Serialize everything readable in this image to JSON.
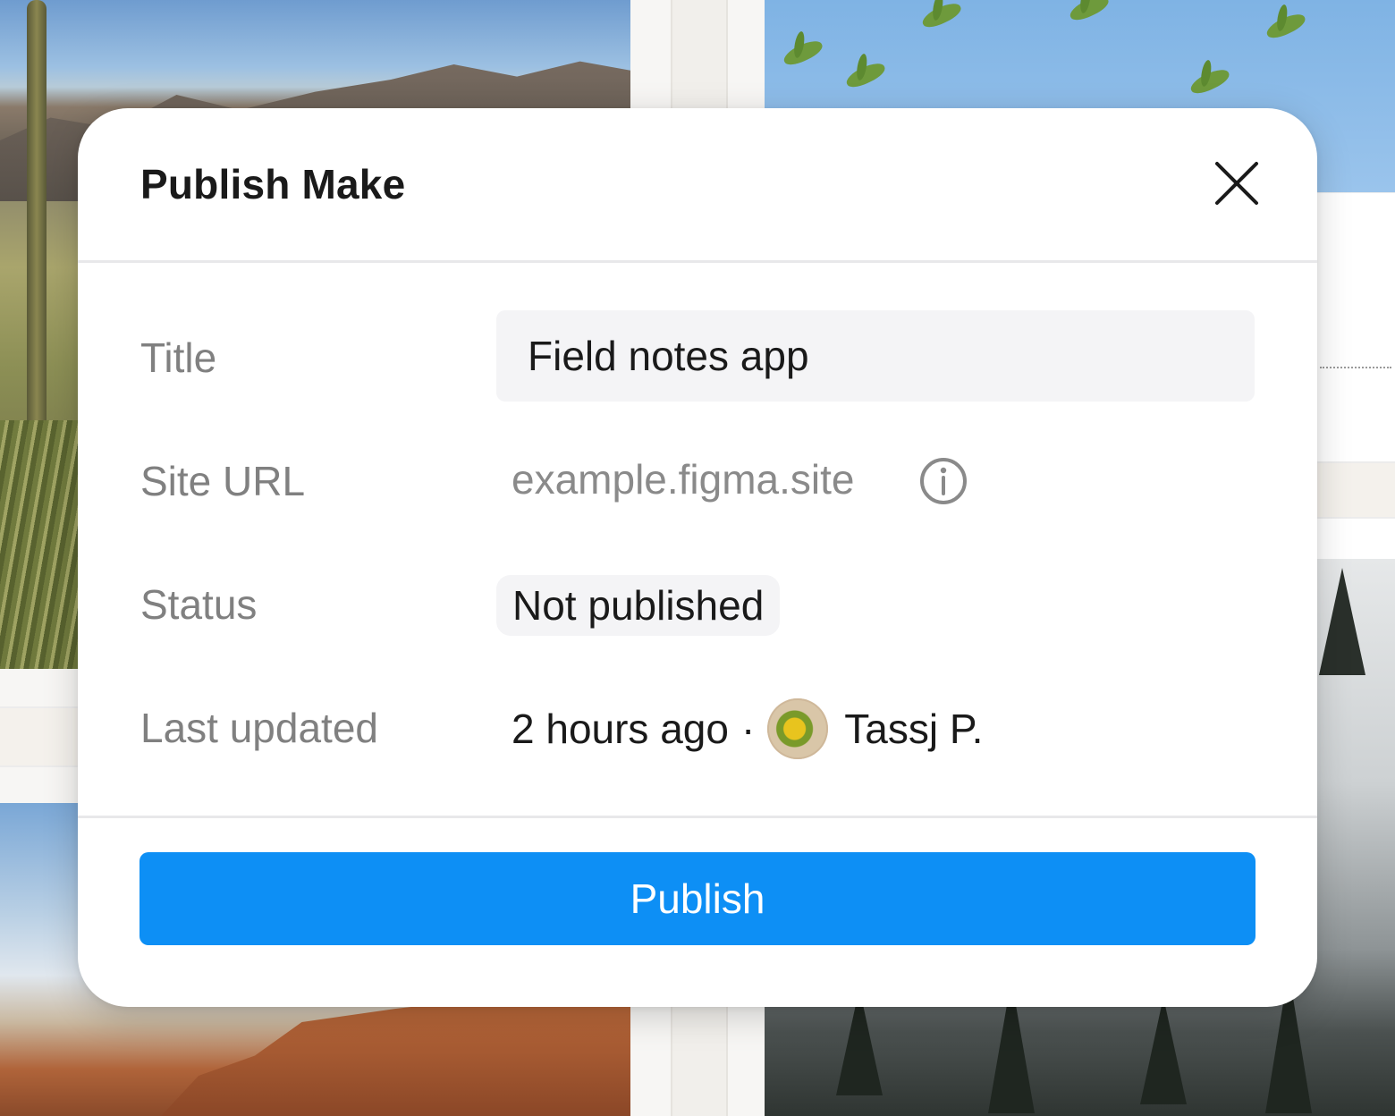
{
  "dialog": {
    "title": "Publish Make",
    "close_icon": "close-icon"
  },
  "fields": {
    "title_label": "Title",
    "title_value": "Field notes app",
    "url_label": "Site URL",
    "url_value": "example.figma.site",
    "url_info_icon": "info-icon",
    "status_label": "Status",
    "status_value": "Not published",
    "updated_label": "Last updated",
    "updated_time": "2 hours ago",
    "updated_separator": "·",
    "updated_user": "Tassj P."
  },
  "footer": {
    "publish_label": "Publish"
  },
  "colors": {
    "accent": "#0d8ff5",
    "label": "#808080",
    "text": "#1a1a1a"
  }
}
